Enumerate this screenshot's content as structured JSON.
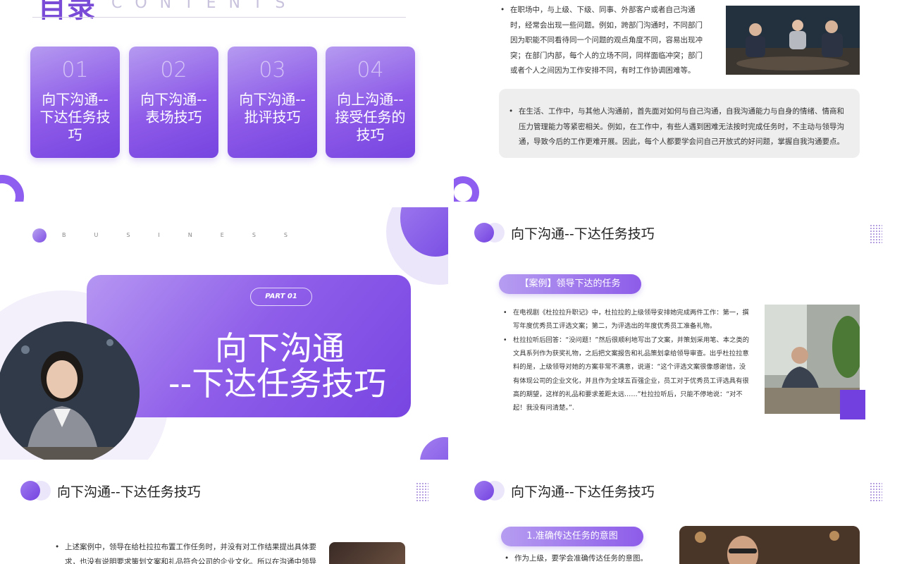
{
  "slide_contents": {
    "title": "目录",
    "subtitle": "CONTENTS",
    "items": [
      {
        "num": "01",
        "label": "向下沟通--下达任务技巧"
      },
      {
        "num": "02",
        "label": "向下沟通--表场技巧"
      },
      {
        "num": "03",
        "label": "向下沟通--批评技巧"
      },
      {
        "num": "04",
        "label": "向上沟通--接受任务的技巧"
      }
    ]
  },
  "slide_problems": {
    "bullet1": "在职场中，与上级、下级、同事、外部客户或者自己沟通时，经常会出现一些问题。例如，跨部门沟通时，不同部门因为职能不同看待同一个问题的观点角度不同，容易出现冲突；在部门内部，每个人的立场不同，同样面临冲突；部门或者个人之间因为工作安排不同，有时工作协调困难等。",
    "bullet2": "在生活、工作中，与其他人沟通前，首先面对如何与自己沟通，自我沟通能力与自身的情绪、情商和压力管理能力等紧密相关。例如，在工作中，有些人遇到困难无法按时完成任务时，不主动与领导沟通，导致今后的工作更难开展。因此，每个人都要学会问自己开放式的好问题，掌握自我沟通要点。"
  },
  "slide_section": {
    "business": "BUSINESS",
    "part": "PART 01",
    "title_line1": "向下沟通",
    "title_line2": "--下达任务技巧"
  },
  "slide_case": {
    "header": "向下沟通--下达任务技巧",
    "pill": "【案例】领导下达的任务",
    "bullet1": "在电视剧《杜拉拉升职记》中，杜拉拉的上级领导安排她完成两件工作：第一，撰写年度优秀员工评选文案；第二，为评选出的年度优秀员工准备礼物。",
    "bullet2": "杜拉拉听后回答：“没问题！”然后很顺利地写出了文案，并策划采用笔、本之类的文具系列作为获奖礼物，之后把文案报告和礼品策划拿给领导审查。出乎杜拉拉意料的是，上级领导对她的方案非常不满意，说道：“这个评选文案很像感谢信，没有体现公司的企业文化，并且作为全球五百强企业，员工对于优秀员工评选具有很高的期望，这样的礼品和要求差距太远……”杜拉拉听后，只能不停地说：“对不起！我没有问清楚。”."
  },
  "slide_analysis": {
    "header": "向下沟通--下达任务技巧",
    "bullet1": "上述案例中，领导在给杜拉拉布置工作任务时，并没有对工作结果提出具体要求，也没有说明要求策划文案和礼品符合公司的企业文化。所以在沟通中领导"
  },
  "slide_intent": {
    "header": "向下沟通--下达任务技巧",
    "pill": "1.准确传达任务的意图",
    "bullet1": "作为上级，要学会准确传达任务的意图。"
  }
}
